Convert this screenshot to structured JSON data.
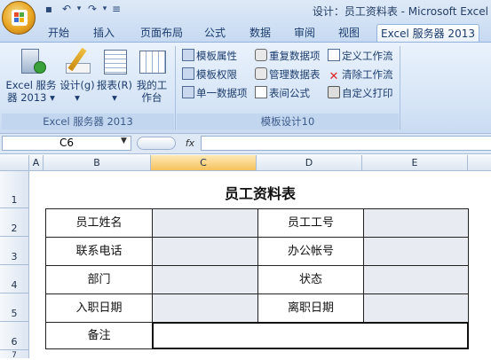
{
  "window": {
    "title": "设计：员工资料表 - Microsoft Excel"
  },
  "quick_access": {
    "save_icon": "save-icon",
    "undo_icon": "undo-icon",
    "redo_icon": "redo-icon",
    "menu_icon": "customize-icon"
  },
  "tabs": [
    {
      "label": "开始"
    },
    {
      "label": "插入"
    },
    {
      "label": "页面布局"
    },
    {
      "label": "公式"
    },
    {
      "label": "数据"
    },
    {
      "label": "审阅"
    },
    {
      "label": "视图"
    },
    {
      "label": "Excel 服务器 2013",
      "active": true
    }
  ],
  "ribbon": {
    "group1": {
      "label": "Excel 服务器 2013",
      "buttons": [
        {
          "label_line1": "Excel 服务",
          "label_line2": "器 2013 ▾",
          "icon": "server-icon"
        },
        {
          "label_line1": "设计(g)",
          "label_line2": "▾",
          "icon": "design-pencil-icon"
        },
        {
          "label_line1": "报表(R)",
          "label_line2": "▾",
          "icon": "report-icon"
        },
        {
          "label_line1": "我的工",
          "label_line2": "作台",
          "icon": "workbench-icon"
        }
      ]
    },
    "group2": {
      "label": "模板设计10",
      "buttons": [
        {
          "label": "模板属性",
          "icon": "template-properties-icon"
        },
        {
          "label": "重复数据项",
          "icon": "repeat-data-icon"
        },
        {
          "label": "定义工作流",
          "icon": "define-workflow-icon"
        },
        {
          "label": "模板权限",
          "icon": "template-permissions-icon"
        },
        {
          "label": "管理数据表",
          "icon": "manage-tables-icon"
        },
        {
          "label": "清除工作流",
          "icon": "clear-workflow-icon"
        },
        {
          "label": "单一数据项",
          "icon": "single-data-icon"
        },
        {
          "label": "表间公式",
          "icon": "formula-icon"
        },
        {
          "label": "自定义打印",
          "icon": "print-icon"
        }
      ]
    }
  },
  "formula_bar": {
    "name_box": "C6",
    "fx": "fx",
    "value": ""
  },
  "grid": {
    "columns": [
      "A",
      "B",
      "C",
      "D",
      "E"
    ],
    "selected_column": "C",
    "rows": [
      "1",
      "2",
      "3",
      "4",
      "5",
      "6",
      "7"
    ]
  },
  "sheet": {
    "title": "员工资料表",
    "form": [
      {
        "label1": "员工姓名",
        "label2": "员工工号"
      },
      {
        "label1": "联系电话",
        "label2": "办公帐号"
      },
      {
        "label1": "部门",
        "label2": "状态"
      },
      {
        "label1": "入职日期",
        "label2": "离职日期"
      }
    ],
    "remark_label": "备注"
  },
  "colors": {
    "accent": "#1b3c6e",
    "selected_header": "#f6c25c",
    "form_fill": "#e8ebf1"
  }
}
